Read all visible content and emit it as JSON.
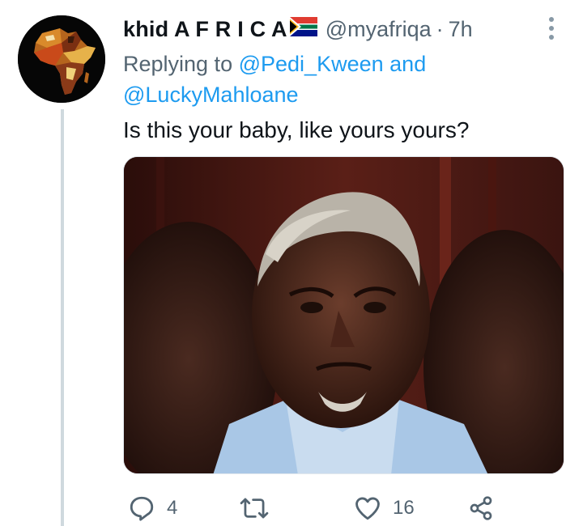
{
  "tweet": {
    "author": {
      "display_name": "khid A F R I C A",
      "flag_icon": "south-africa-flag-icon",
      "handle": "@myafriqa",
      "separator": "·",
      "time": "7h",
      "avatar_icon": "africa-map-avatar"
    },
    "reply": {
      "prefix": "Replying to",
      "mention_1": "@Pedi_Kween",
      "joiner": "and",
      "mention_2": "@LuckyMahloane"
    },
    "text": "Is this your baby, like yours yours?",
    "media": {
      "kind": "photo",
      "description_icon": "photo-of-elderly-man"
    },
    "actions": {
      "reply_count": "4",
      "retweet_count": "",
      "like_count": "16"
    }
  },
  "colors": {
    "link": "#1d9bf0",
    "secondary_text": "#536471",
    "primary_text": "#0f1419",
    "thread_line": "#cfd9de"
  }
}
